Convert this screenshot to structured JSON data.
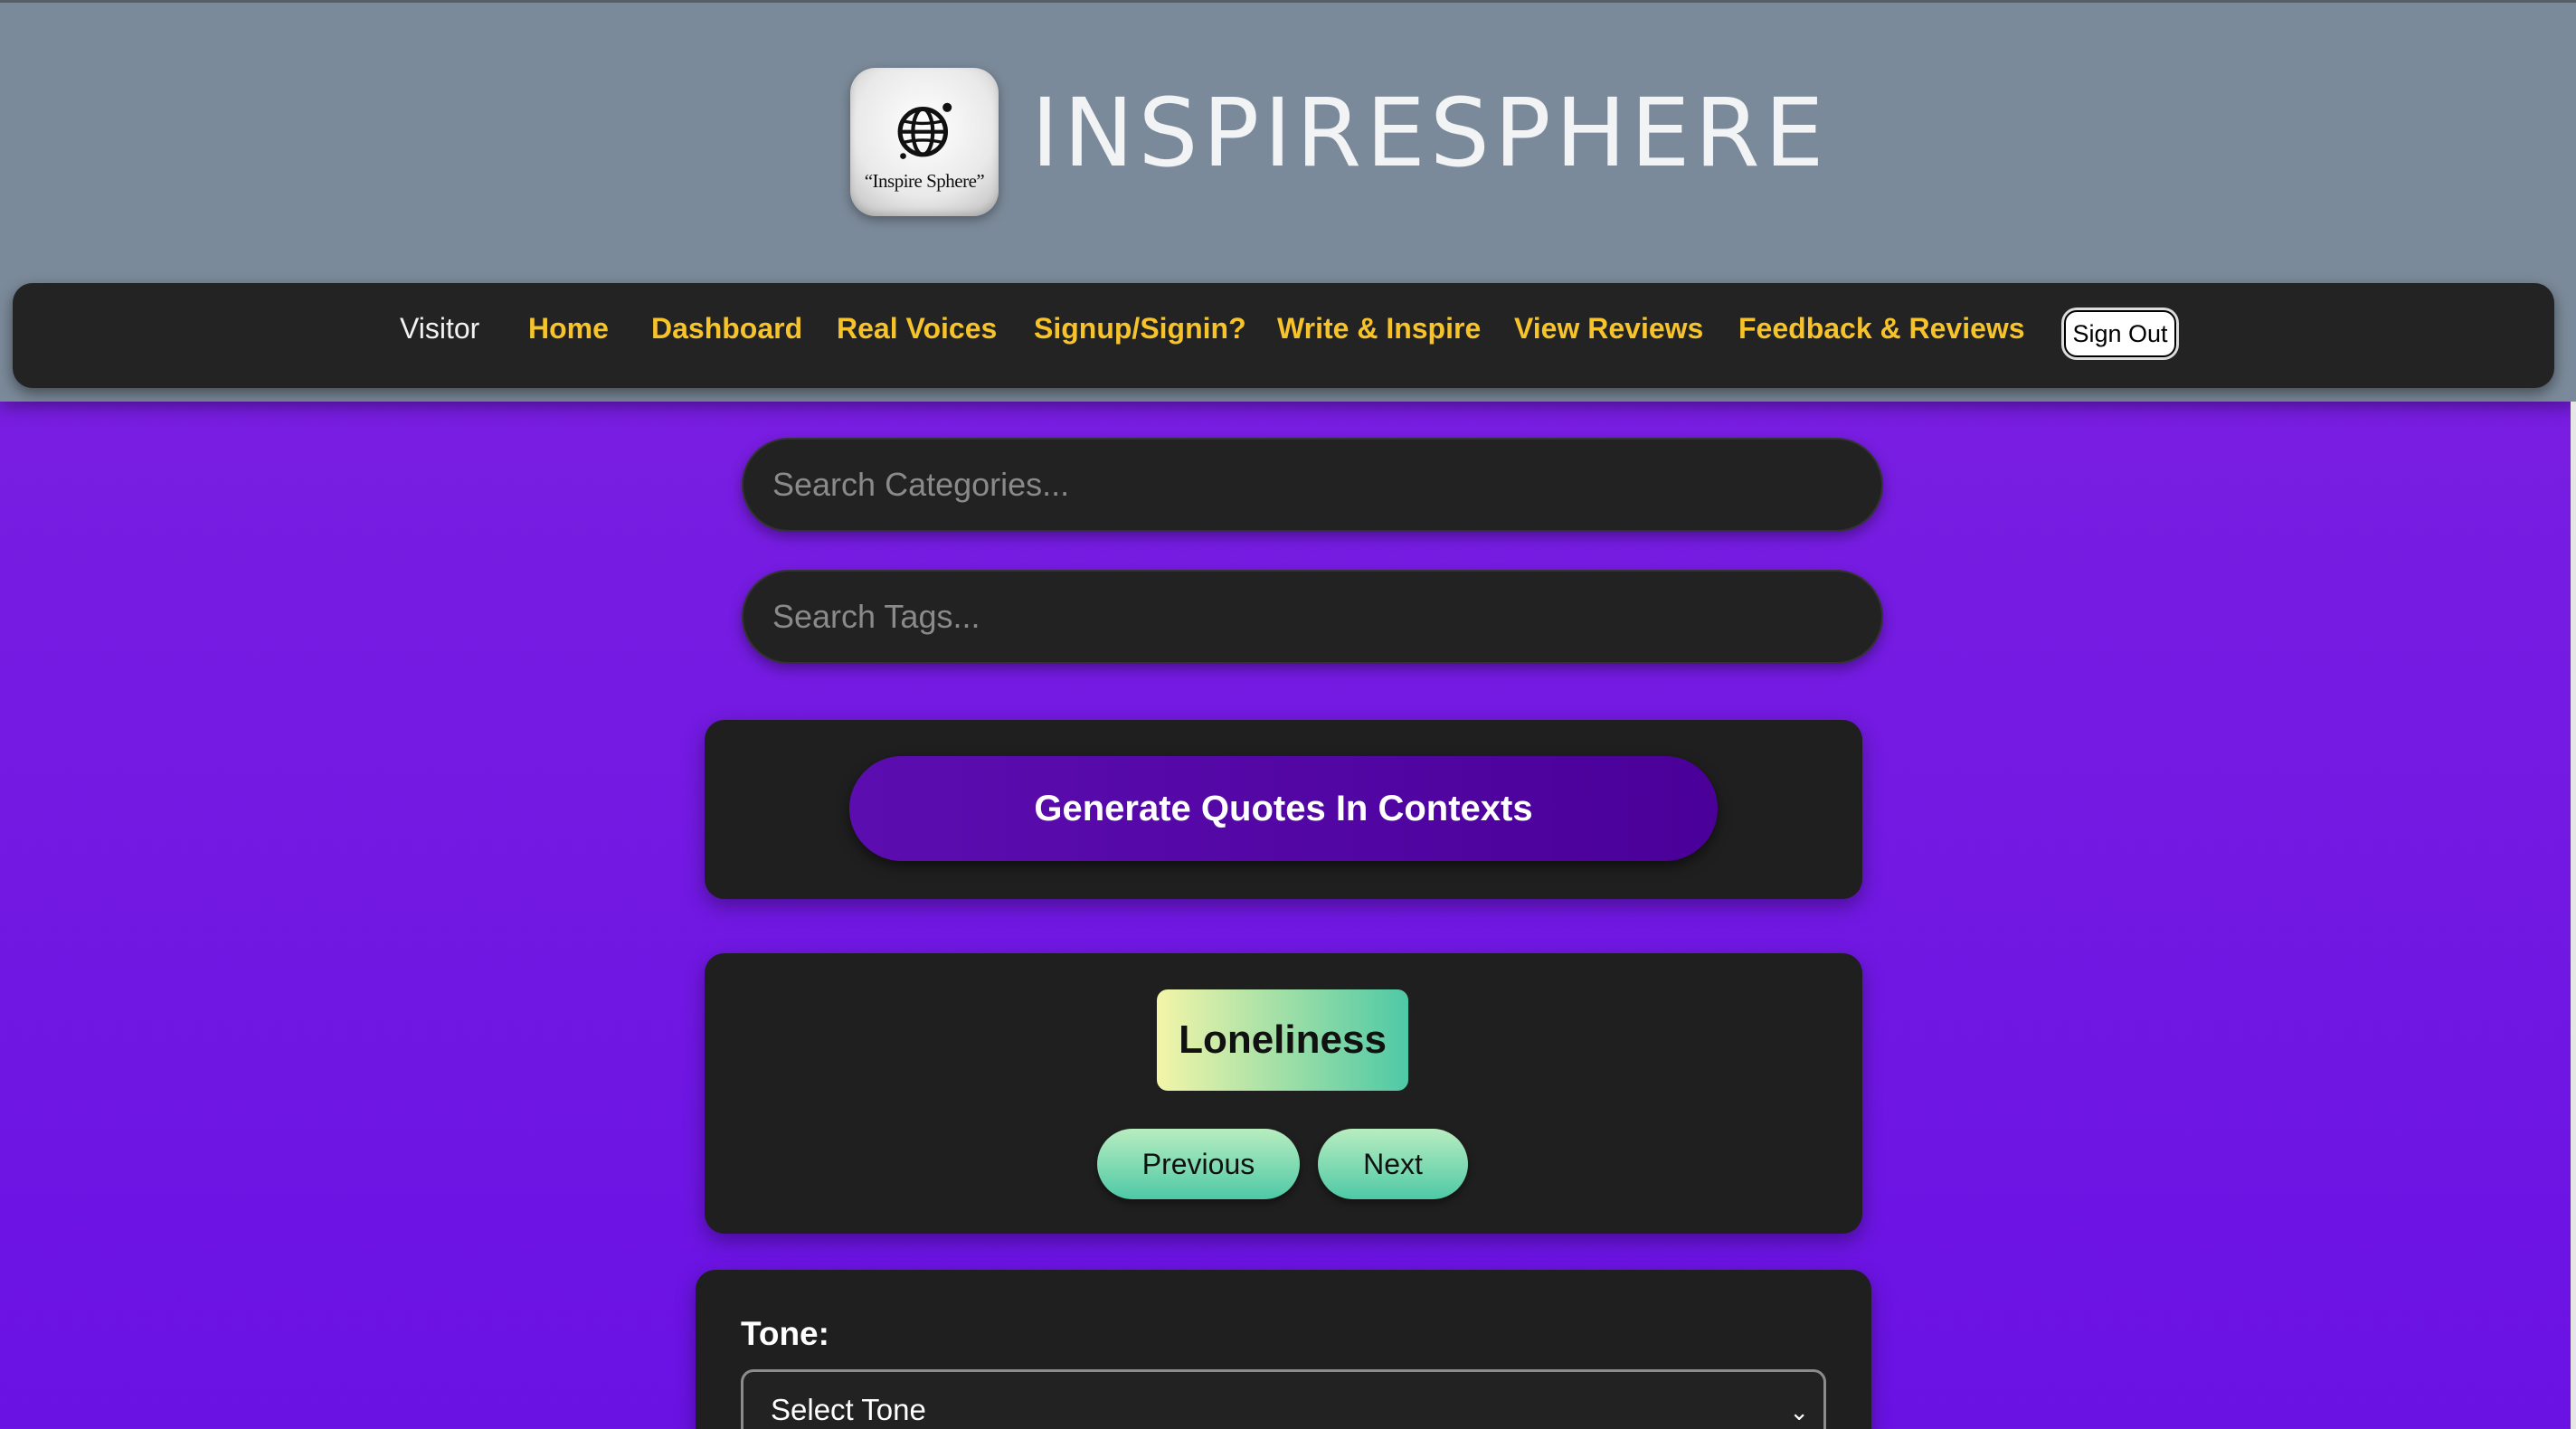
{
  "brand": {
    "name": "INSPIRESPHERE",
    "logo_caption": "“Inspire Sphere”",
    "logo_icon": "globe-icon"
  },
  "nav": {
    "visitor_label": "Visitor",
    "items": [
      {
        "label": "Home"
      },
      {
        "label": "Dashboard"
      },
      {
        "label": "Real Voices"
      },
      {
        "label": "Signup/Signin?"
      },
      {
        "label": "Write & Inspire"
      },
      {
        "label": "View Reviews"
      },
      {
        "label": "Feedback & Reviews"
      }
    ],
    "sign_out_label": "Sign Out"
  },
  "search": {
    "categories_placeholder": "Search Categories...",
    "tags_placeholder": "Search Tags..."
  },
  "generate": {
    "button_label": "Generate Quotes In Contexts"
  },
  "category": {
    "current": "Loneliness",
    "previous_label": "Previous",
    "next_label": "Next"
  },
  "tone": {
    "label": "Tone:",
    "selected": "Select Tone"
  },
  "colors": {
    "header_bg": "#7b8a9a",
    "nav_bg": "#232323",
    "nav_link": "#f7c32a",
    "page_bg_top": "#7e22e0",
    "page_bg_bottom": "#6a12e4",
    "card_bg": "#1f1f1f",
    "generate_button": "#5c0db0"
  }
}
